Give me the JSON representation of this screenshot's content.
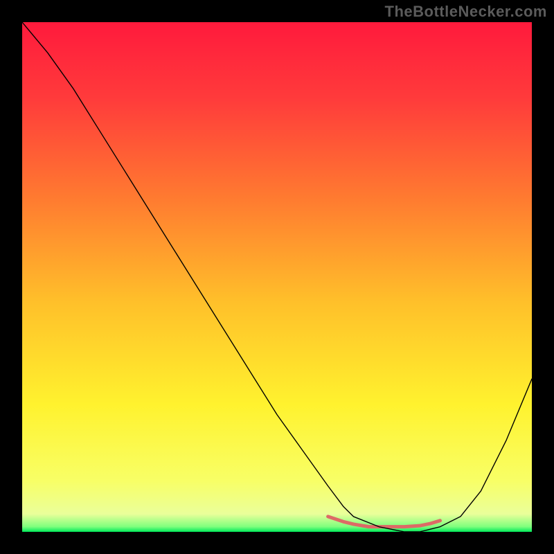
{
  "watermark": "TheBottleNecker.com",
  "chart_data": {
    "type": "line",
    "title": "",
    "xlabel": "",
    "ylabel": "",
    "xlim": [
      0,
      100
    ],
    "ylim": [
      0,
      100
    ],
    "series": [
      {
        "name": "bottleneck-curve",
        "x": [
          0,
          5,
          10,
          15,
          20,
          25,
          30,
          35,
          40,
          45,
          50,
          55,
          60,
          63,
          65,
          70,
          75,
          78,
          82,
          86,
          90,
          95,
          100
        ],
        "values": [
          100,
          94,
          87,
          79,
          71,
          63,
          55,
          47,
          39,
          31,
          23,
          16,
          9,
          5,
          3,
          1,
          0,
          0,
          1,
          3,
          8,
          18,
          30
        ]
      },
      {
        "name": "marker-band",
        "x": [
          60,
          63,
          65,
          68,
          70,
          73,
          75,
          78,
          80,
          82
        ],
        "values": [
          3,
          2,
          1.5,
          1,
          1,
          1,
          1,
          1.2,
          1.6,
          2.2
        ]
      }
    ],
    "colors": {
      "curve": "#000000",
      "marker": "#dd6a66",
      "gradient_stops": [
        {
          "offset": 0.0,
          "color": "#ff1a3c"
        },
        {
          "offset": 0.15,
          "color": "#ff3b3b"
        },
        {
          "offset": 0.35,
          "color": "#ff7c30"
        },
        {
          "offset": 0.55,
          "color": "#ffc02a"
        },
        {
          "offset": 0.75,
          "color": "#fff22e"
        },
        {
          "offset": 0.9,
          "color": "#f8ff66"
        },
        {
          "offset": 0.965,
          "color": "#eaff9a"
        },
        {
          "offset": 0.99,
          "color": "#7dff7d"
        },
        {
          "offset": 1.0,
          "color": "#00e85a"
        }
      ]
    }
  }
}
